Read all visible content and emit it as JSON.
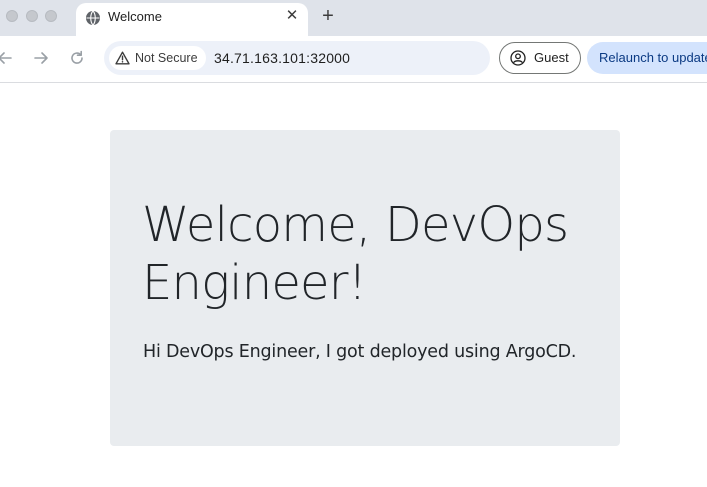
{
  "browser": {
    "tab": {
      "title": "Welcome",
      "close_glyph": "✕",
      "icon": "globe-icon"
    },
    "new_tab_glyph": "+",
    "address_bar": {
      "security_label": "Not Secure",
      "security_icon": "warning-icon",
      "url": "34.71.163.101:32000"
    },
    "profile": {
      "label": "Guest",
      "icon": "profile-icon"
    },
    "update_button": {
      "label": "Relaunch to update"
    },
    "annotation_arrow_color": "#e8674a"
  },
  "page": {
    "title": "Welcome, DevOps Engineer!",
    "lead": "Hi DevOps Engineer, I got deployed using ArgoCD."
  }
}
